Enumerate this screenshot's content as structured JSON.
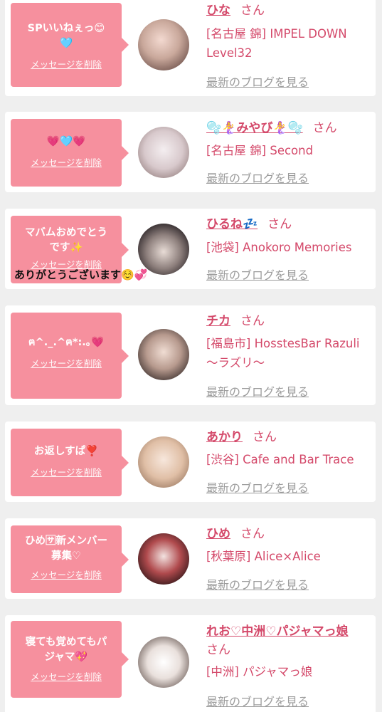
{
  "delete_label": "メッセージを削除",
  "blog_label": "最新のブログを見る",
  "honorific": "さん",
  "overlay_note": "ありがとうございます☺️💞",
  "entries": [
    {
      "message": "SPいいねぇっ😊\n🩵",
      "name": "ひな",
      "shop": "[名古屋 錦] IMPEL DOWN Level32"
    },
    {
      "message": "💗🩵💗",
      "name": "🫧🧜‍♀️みやび🧜‍♀️🫧",
      "shop": "[名古屋 錦] Second"
    },
    {
      "message": "マバムおめでとう\nです✨",
      "name": "ひるね💤",
      "shop": "[池袋] Anokoro Memories"
    },
    {
      "message": "ฅ^._.^ฅ*:.｡💗",
      "name": "チカ",
      "shop": "[福島市] HosstesBar Razuli 〜ラズリ〜"
    },
    {
      "message": "お返しすぱ❣️",
      "name": "あかり",
      "shop": "[渋谷] Cafe and Bar Trace"
    },
    {
      "message": "ひめ🈂新メンバー\n募集♡",
      "name": "ひめ",
      "shop": "[秋葉原] Alice×Alice"
    },
    {
      "message": "寝ても覚めてもパ\nジャマ💖",
      "name": "れお♡中洲♡パジャマっ娘",
      "shop": "[中洲] パジャマっ娘"
    }
  ]
}
